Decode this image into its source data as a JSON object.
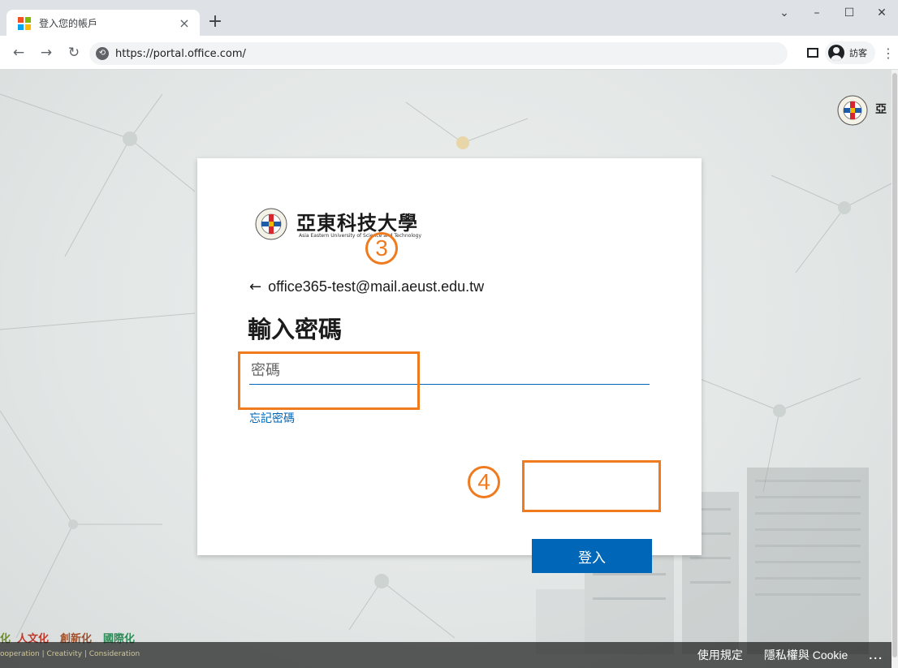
{
  "browser": {
    "tab_title": "登入您的帳戶",
    "url": "https://portal.office.com/",
    "guest_label": "訪客",
    "colors": {
      "ms_red": "#f25022",
      "ms_green": "#7fba00",
      "ms_blue": "#00a4ef",
      "ms_yellow": "#ffb900"
    }
  },
  "page": {
    "motto": [
      "化",
      "人文化",
      "創新化",
      "國際化"
    ],
    "motto_sub": "ooperation | Creativity | Consideration",
    "footer": {
      "terms": "使用規定",
      "privacy": "隱私權與 Cookie",
      "more": "..."
    },
    "corner_mark": "亞"
  },
  "card": {
    "university_name": "亞東科技大學",
    "university_name_en": "Asia Eastern University of Science and Technology",
    "account": "office365-test@mail.aeust.edu.tw",
    "heading": "輸入密碼",
    "password_placeholder": "密碼",
    "forgot_password": "忘記密碼",
    "submit": "登入",
    "step_labels": {
      "step3": "3",
      "step4": "4"
    },
    "accent_color": "#0067b8",
    "highlight_color": "#f07b1f"
  }
}
